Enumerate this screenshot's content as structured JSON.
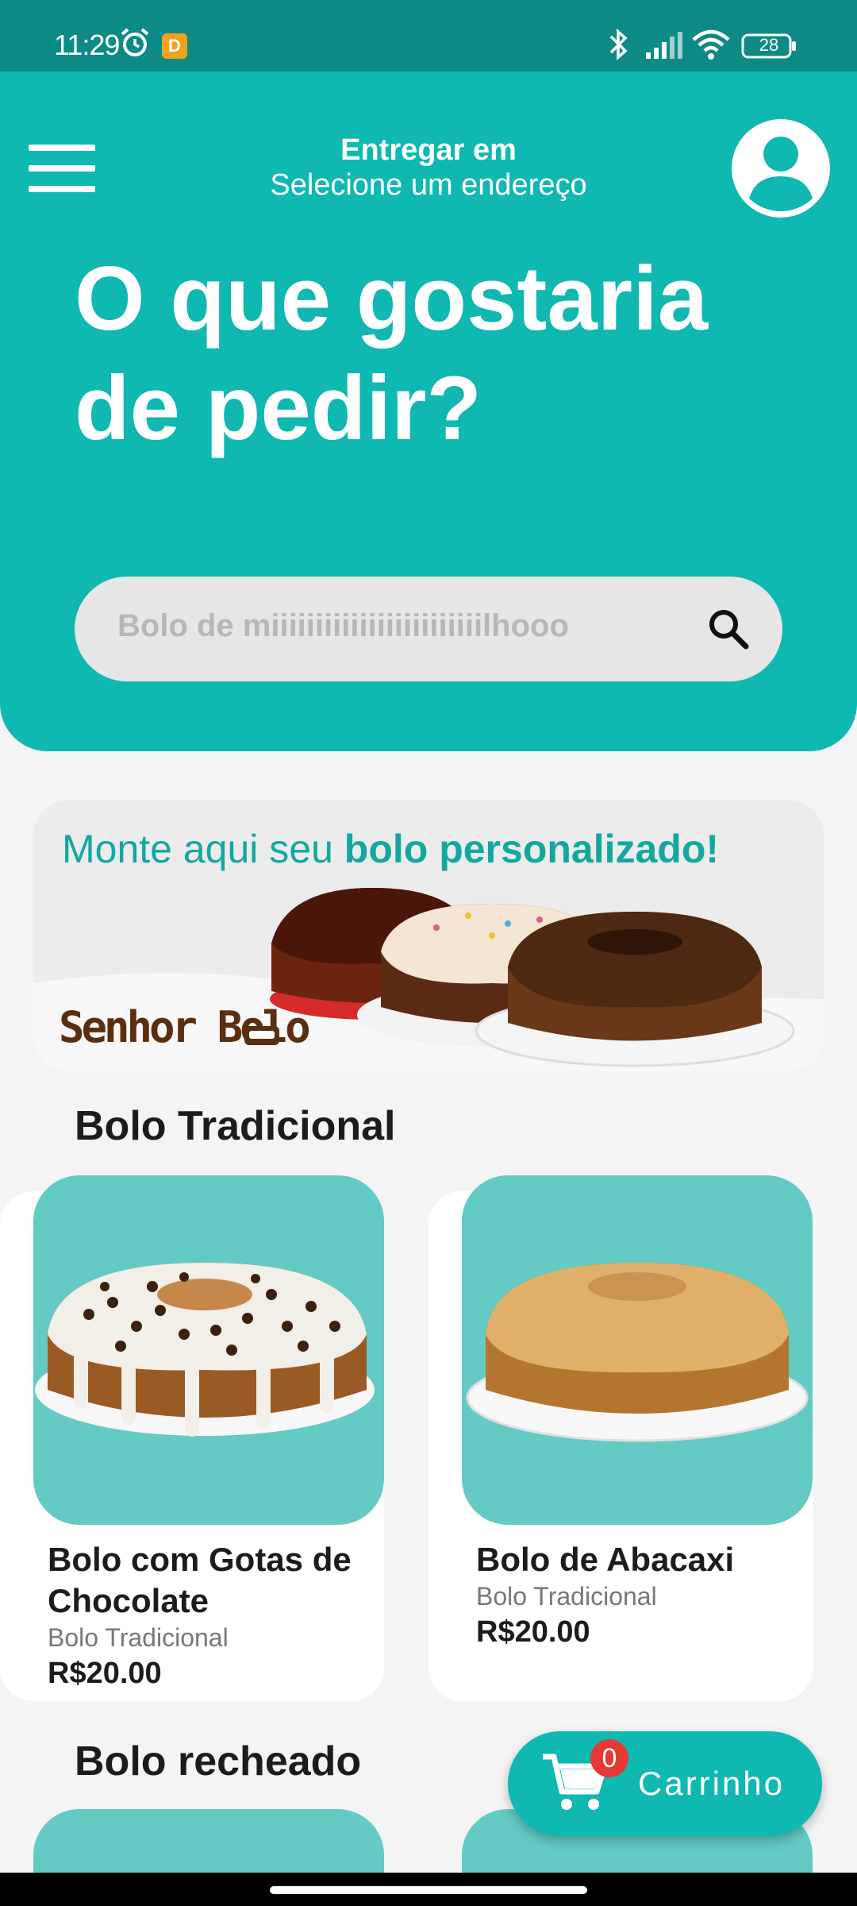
{
  "status_bar": {
    "time": "11:29",
    "app_badge": "D",
    "battery": "28",
    "icons": [
      "alarm-icon",
      "bluetooth-icon",
      "signal-icon",
      "wifi-icon",
      "battery-icon"
    ]
  },
  "header": {
    "deliver_title": "Entregar em",
    "deliver_subtitle": "Selecione um endereço",
    "hero_line1": "O que gostaria",
    "hero_line2": "de pedir?",
    "search_placeholder": "Bolo de miiiiiiiiiiiiiiiiiiiiiiiilhooo"
  },
  "banner": {
    "text_normal": "Monte aqui seu ",
    "text_bold": "bolo personalizado!",
    "brand": "Senhor Bolo"
  },
  "sections": [
    {
      "title": "Bolo Tradicional",
      "products": [
        {
          "name": "Bolo com Gotas de Chocolate",
          "category": "Bolo Tradicional",
          "price": "R$20.00"
        },
        {
          "name": "Bolo de Abacaxi",
          "category": "Bolo Tradicional",
          "price": "R$20.00"
        }
      ]
    },
    {
      "title": "Bolo recheado",
      "products": []
    }
  ],
  "cart": {
    "count": "0",
    "label": "Carrinho"
  },
  "colors": {
    "primary": "#0fb8b1",
    "status_bar": "#0e8a86",
    "card_image_bg": "#63cac4",
    "badge": "#e53935",
    "banner_text": "#13a7a1"
  }
}
